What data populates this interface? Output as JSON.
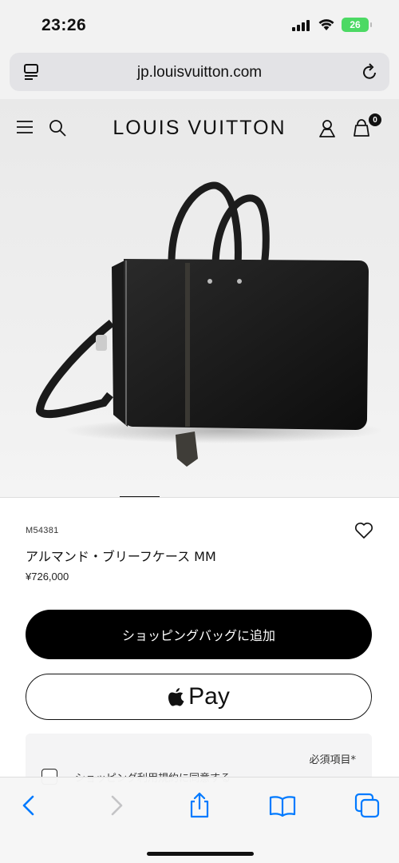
{
  "status_bar": {
    "time": "23:26",
    "battery": "26"
  },
  "browser": {
    "url": "jp.louisvuitton.com"
  },
  "site_header": {
    "brand": "LOUIS VUITTON",
    "bag_count": "0"
  },
  "product": {
    "sku": "M54381",
    "name": "アルマンド・ブリーフケース MM",
    "price": "¥726,000",
    "image_alt": "product-photo"
  },
  "actions": {
    "add_to_bag_label": "ショッピングバッグに追加",
    "apple_pay_label": "Pay"
  },
  "terms": {
    "required_label": "必須項目*",
    "checkbox_label": "ショッピング利用規約に同意する"
  },
  "colors": {
    "accent": "#000000",
    "browser_chrome": "#f2f2f2",
    "ios_blue": "#007aff",
    "battery_green": "#4cd964"
  },
  "icons": {
    "status": [
      "signal-icon",
      "wifi-icon",
      "battery-icon"
    ],
    "browser": [
      "page-menu-icon",
      "reload-icon"
    ],
    "header": [
      "menu-icon",
      "search-icon",
      "account-icon",
      "shopping-bag-icon"
    ],
    "product": [
      "heart-icon"
    ],
    "toolbar": [
      "back-icon",
      "forward-icon",
      "share-icon",
      "bookmarks-icon",
      "tabs-icon"
    ]
  }
}
